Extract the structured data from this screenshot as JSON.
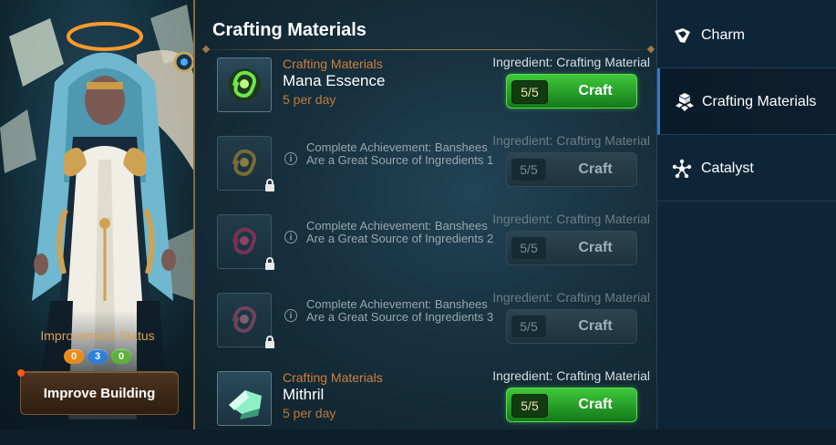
{
  "left": {
    "improvement_status_label": "Improvement Status",
    "status_counts": [
      "0",
      "3",
      "0"
    ],
    "improve_button": "Improve Building"
  },
  "main": {
    "title": "Crafting Materials",
    "items": [
      {
        "locked": false,
        "category": "Crafting Materials",
        "name": "Mana Essence",
        "rate": "5 per day",
        "ingredient": "Ingredient: Crafting Material",
        "count": "5/5",
        "craft_label": "Craft"
      },
      {
        "locked": true,
        "achievement": "Complete Achievement: Banshees Are a Great Source of Ingredients 1",
        "ingredient": "Ingredient: Crafting Material",
        "count": "5/5",
        "craft_label": "Craft"
      },
      {
        "locked": true,
        "achievement": "Complete Achievement: Banshees Are a Great Source of Ingredients 2",
        "ingredient": "Ingredient: Crafting Material",
        "count": "5/5",
        "craft_label": "Craft"
      },
      {
        "locked": true,
        "achievement": "Complete Achievement: Banshees Are a Great Source of Ingredients 3",
        "ingredient": "Ingredient: Crafting Material",
        "count": "5/5",
        "craft_label": "Craft"
      },
      {
        "locked": false,
        "category": "Crafting Materials",
        "name": "Mithril",
        "rate": "5 per day",
        "ingredient": "Ingredient: Crafting Material",
        "count": "5/5",
        "craft_label": "Craft"
      }
    ]
  },
  "tabs": [
    {
      "label": "Charm",
      "icon": "charm-icon",
      "selected": false
    },
    {
      "label": "Crafting Materials",
      "icon": "crafting-materials-icon",
      "selected": true
    },
    {
      "label": "Catalyst",
      "icon": "catalyst-icon",
      "selected": false
    }
  ],
  "colors": {
    "craft_active": "#2fae2c",
    "accent_orange": "#d07e3c",
    "tab_bg": "#0e2538"
  }
}
